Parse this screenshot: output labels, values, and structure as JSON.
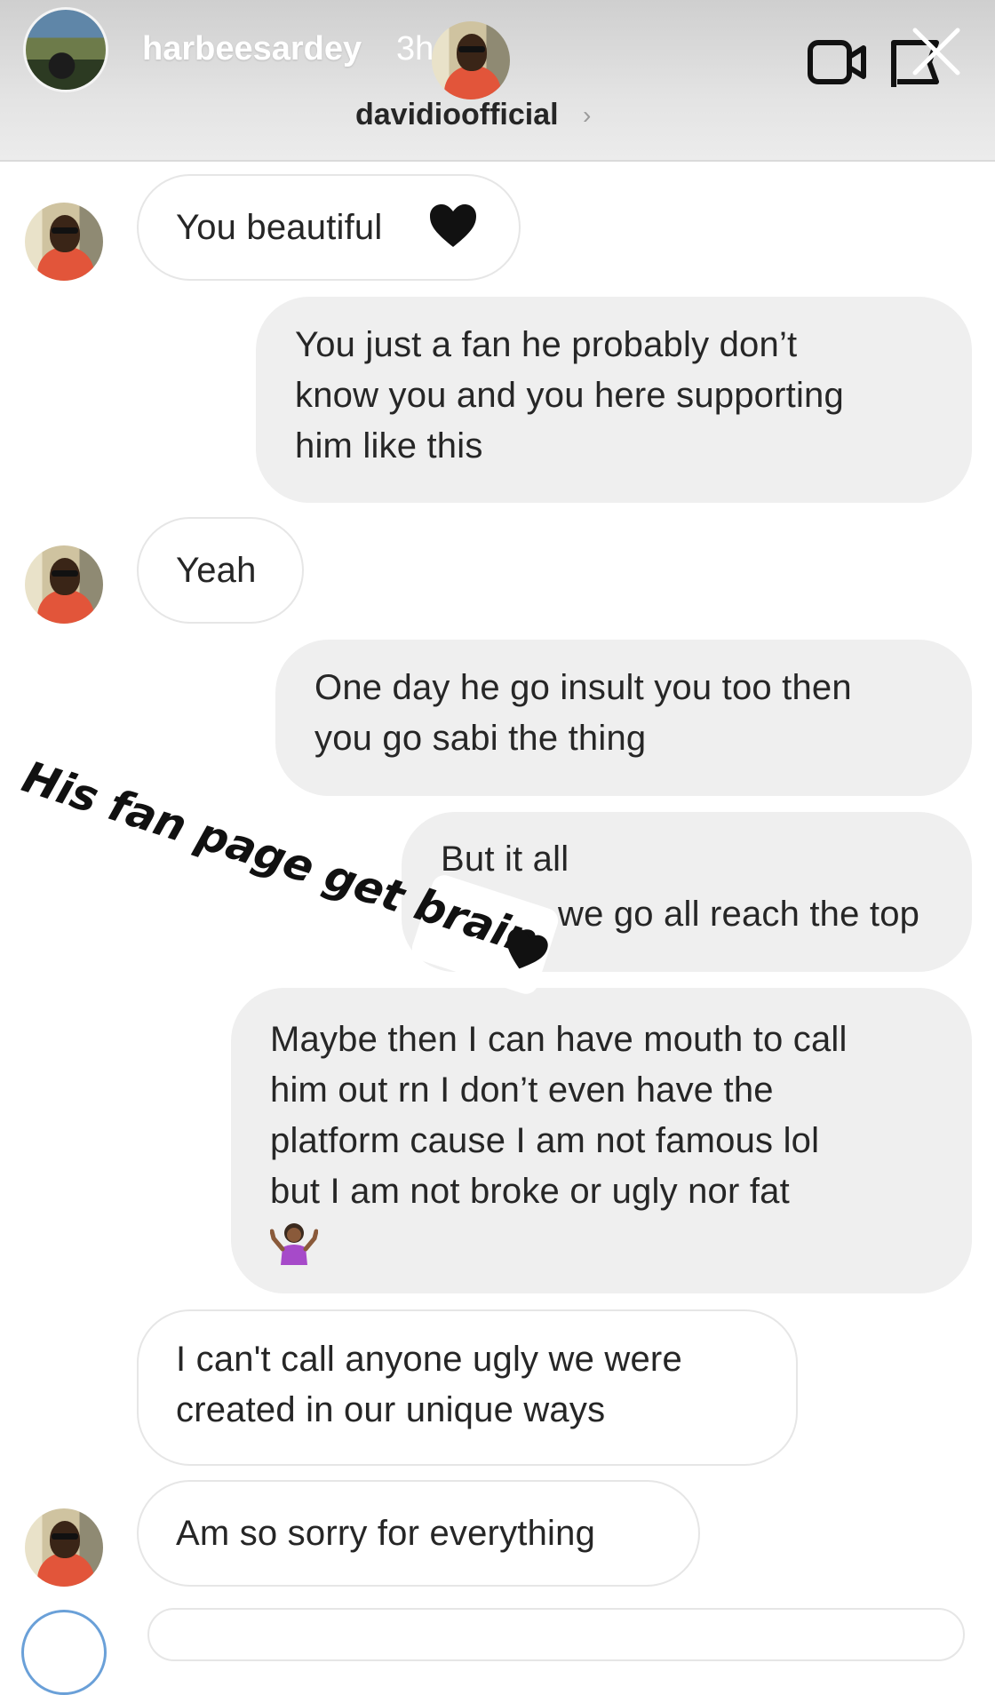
{
  "story": {
    "username": "harbeesardey",
    "time": "3h"
  },
  "chat": {
    "username": "davidioofficial",
    "chevron": "›"
  },
  "messages": [
    {
      "side": "received",
      "text": "You beautiful",
      "icon": "black-heart-icon"
    },
    {
      "side": "sent",
      "lines": [
        "You just a fan he probably don’t",
        "know you and you here supporting",
        "him like this"
      ]
    },
    {
      "side": "received",
      "text": "Yeah"
    },
    {
      "side": "sent",
      "lines": [
        "One day he go insult you too then",
        "you go sabi the thing"
      ]
    },
    {
      "side": "sent",
      "lines": [
        "But it all",
        "we go all reach the top"
      ]
    },
    {
      "side": "sent",
      "lines": [
        "Maybe then I can have mouth to call",
        "him out rn I don’t even have the",
        "platform cause I am not famous lol",
        "but I am not broke or ugly nor fat"
      ],
      "icon": "shrugging-woman-icon"
    },
    {
      "side": "received",
      "lines": [
        "I can't call anyone ugly we were",
        "created in our unique ways"
      ]
    },
    {
      "side": "received",
      "text": "Am so sorry for everything"
    }
  ],
  "sticker": {
    "text": "His fan page get brain",
    "icon": "black-heart-icon"
  },
  "colors": {
    "sent_bubble": "#efefef",
    "received_border": "#e6e6e6",
    "text": "#262626"
  }
}
